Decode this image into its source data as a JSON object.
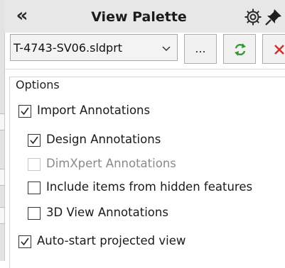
{
  "panel": {
    "title": "View Palette",
    "collapse_glyph": "«",
    "header_icons": [
      "gear-icon",
      "pushpin-icon"
    ]
  },
  "file_selector": {
    "value": "T-4743-SV06.sldprt",
    "icon": "chevron-down-icon"
  },
  "toolbar": {
    "browse_label": "...",
    "refresh_icon": "refresh-icon",
    "clear_icon": "close-icon"
  },
  "options": {
    "legend": "Options",
    "items": [
      {
        "label": "Import Annotations",
        "checked": true,
        "enabled": true
      },
      {
        "label": "Design Annotations",
        "checked": true,
        "enabled": true
      },
      {
        "label": "DimXpert Annotations",
        "checked": false,
        "enabled": false
      },
      {
        "label": "Include items from hidden features",
        "checked": false,
        "enabled": true
      },
      {
        "label": "3D View Annotations",
        "checked": false,
        "enabled": true
      },
      {
        "label": "Auto-start projected view",
        "checked": true,
        "enabled": true
      }
    ]
  },
  "colors": {
    "header_bg": "#e7e7e7",
    "refresh_green": "#2f9a2f",
    "clear_red": "#d03030"
  }
}
